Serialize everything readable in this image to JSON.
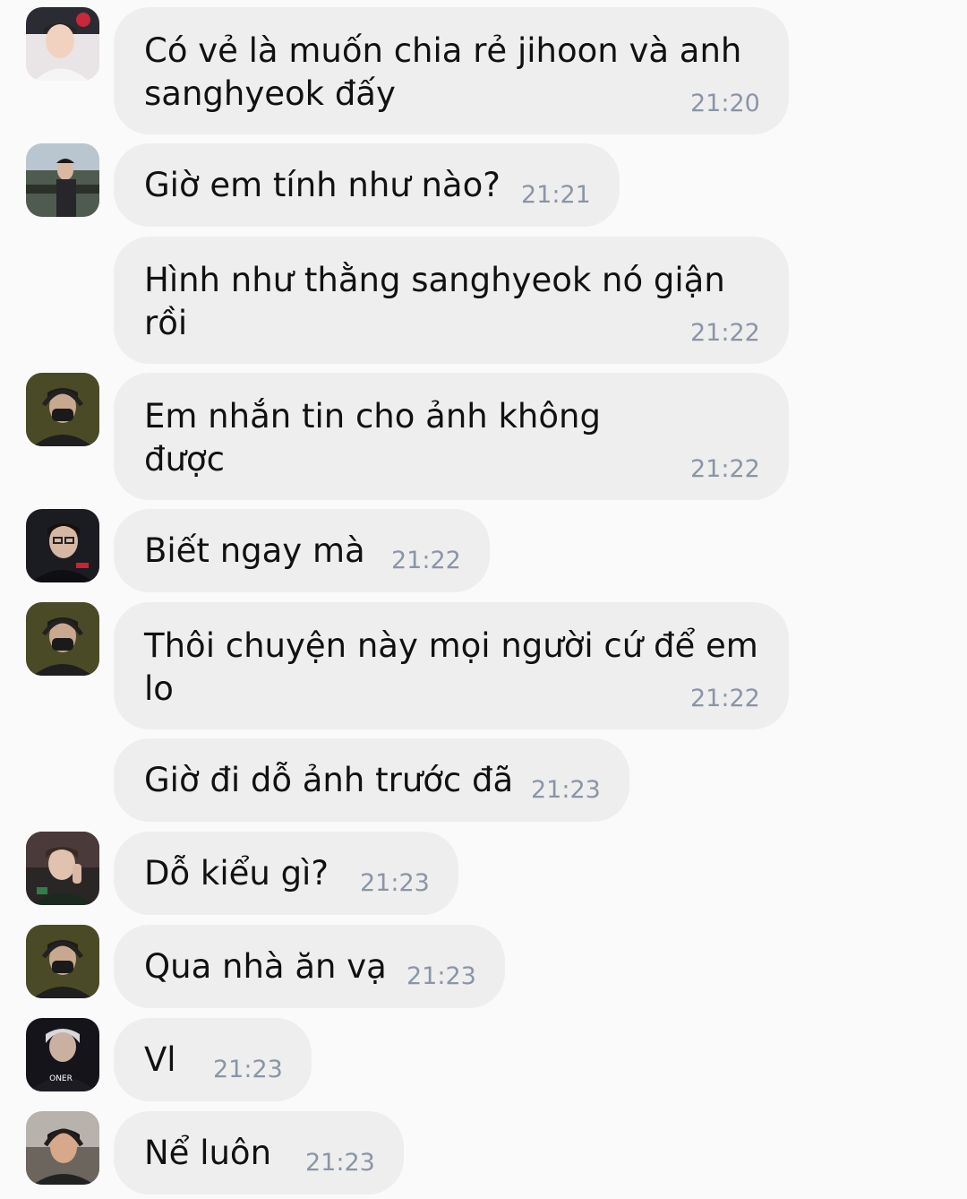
{
  "messages": [
    {
      "avatar": "avatar-1",
      "lines": [
        "Có vẻ là muốn chia rẻ jihoon và anh",
        "sanghyeok đấy"
      ],
      "time": "21:20"
    },
    {
      "avatar": "avatar-2",
      "lines": [
        "Giờ em tính như nào?"
      ],
      "time": "21:21"
    },
    {
      "avatar": null,
      "lines": [
        "Hình như thằng sanghyeok nó giận",
        "rồi"
      ],
      "time": "21:22"
    },
    {
      "avatar": "avatar-3",
      "lines": [
        "Em nhắn tin cho ảnh không",
        "được"
      ],
      "time": "21:22"
    },
    {
      "avatar": "avatar-4",
      "lines": [
        "Biết ngay mà"
      ],
      "time": "21:22"
    },
    {
      "avatar": "avatar-3",
      "lines": [
        "Thôi chuyện này mọi người cứ để em",
        "lo"
      ],
      "time": "21:22"
    },
    {
      "avatar": null,
      "lines": [
        "Giờ đi dỗ ảnh trước đã"
      ],
      "time": "21:23"
    },
    {
      "avatar": "avatar-5",
      "lines": [
        "Dỗ kiểu gì?"
      ],
      "time": "21:23"
    },
    {
      "avatar": "avatar-3",
      "lines": [
        "Qua nhà ăn vạ"
      ],
      "time": "21:23"
    },
    {
      "avatar": "avatar-6",
      "lines": [
        "Vl"
      ],
      "time": "21:23",
      "avatar_caption": "ONER"
    },
    {
      "avatar": "avatar-7",
      "lines": [
        "Nể luôn"
      ],
      "time": "21:23"
    }
  ],
  "colors": {
    "background": "#fafafa",
    "bubble": "#eeeeee",
    "text": "#111111",
    "timestamp": "#8a95a6"
  }
}
